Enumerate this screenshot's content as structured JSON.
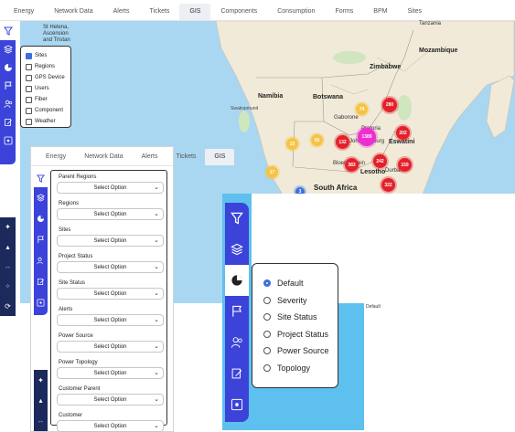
{
  "top_tabs": [
    "Energy",
    "Network Data",
    "Alerts",
    "Tickets",
    "GIS",
    "Components",
    "Consumption",
    "Forms",
    "BPM",
    "Sites"
  ],
  "top_active": "GIS",
  "map_labels": [
    {
      "text": "St Helena,\nAscension\nand Tristan"
    },
    {
      "text": "Tanzania"
    },
    {
      "text": "Mozambique"
    },
    {
      "text": "Zimbabwe"
    },
    {
      "text": "Namibia"
    },
    {
      "text": "Botswana"
    },
    {
      "text": "Gaborone"
    },
    {
      "text": "Swakopmund"
    },
    {
      "text": "Pretoria"
    },
    {
      "text": "Johannesburg"
    },
    {
      "text": "Eswatini"
    },
    {
      "text": "Bloemfontein"
    },
    {
      "text": "Lesotho"
    },
    {
      "text": "Durban"
    },
    {
      "text": "South Africa"
    }
  ],
  "clusters": [
    {
      "count": "280",
      "color": "#e3212b"
    },
    {
      "count": "74",
      "color": "#f6c344"
    },
    {
      "count": "1389",
      "color": "#ee2fd0"
    },
    {
      "count": "132",
      "color": "#e3212b"
    },
    {
      "count": "202",
      "color": "#e3212b"
    },
    {
      "count": "15",
      "color": "#f6c344"
    },
    {
      "count": "50",
      "color": "#f6c344"
    },
    {
      "count": "383",
      "color": "#e3212b"
    },
    {
      "count": "242",
      "color": "#e3212b"
    },
    {
      "count": "159",
      "color": "#e3212b"
    },
    {
      "count": "17",
      "color": "#f6c344"
    },
    {
      "count": "322",
      "color": "#e3212b"
    },
    {
      "count": "3",
      "color": "#3b6fe0"
    }
  ],
  "layer_panel": {
    "items": [
      {
        "label": "Sites",
        "checked": true
      },
      {
        "label": "Regions",
        "checked": false
      },
      {
        "label": "GPS Device",
        "checked": false
      },
      {
        "label": "Users",
        "checked": false
      },
      {
        "label": "Fiber",
        "checked": false
      },
      {
        "label": "Component",
        "checked": false
      },
      {
        "label": "Weather",
        "checked": false
      }
    ]
  },
  "second_tabs": [
    "Energy",
    "Network Data",
    "Alerts",
    "Tickets",
    "GIS"
  ],
  "second_active": "GIS",
  "filters": {
    "select_placeholder": "Select Option",
    "groups": [
      "Parent Regions",
      "Regions",
      "Sites",
      "Project Status",
      "Site Status",
      "Alerts",
      "Power Source",
      "Power Topology",
      "Customer Parent",
      "Customer"
    ]
  },
  "legend_options": {
    "items": [
      {
        "label": "Default",
        "selected": true
      },
      {
        "label": "Severity",
        "selected": false
      },
      {
        "label": "Site Status",
        "selected": false
      },
      {
        "label": "Project Status",
        "selected": false
      },
      {
        "label": "Power Source",
        "selected": false
      },
      {
        "label": "Topology",
        "selected": false
      }
    ]
  },
  "attribution": "Default",
  "colors": {
    "rail": "#3b43d9",
    "map_water": "#a9d7f1",
    "land": "#f1ead9",
    "accent": "#3b6fe0"
  }
}
